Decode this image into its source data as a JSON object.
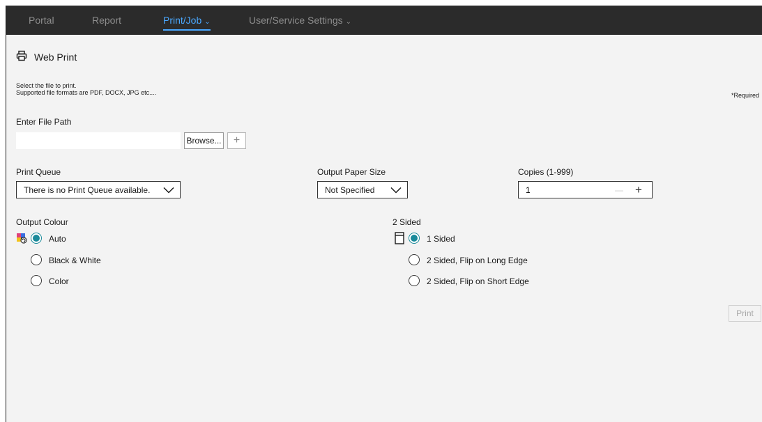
{
  "nav": {
    "items": [
      {
        "label": "Portal"
      },
      {
        "label": "Report"
      },
      {
        "label": "Print/Job"
      },
      {
        "label": "User/Service Settings"
      }
    ],
    "dropdown_marker": "⌄",
    "active_color": "#4aa8ff"
  },
  "page": {
    "title": "Web Print",
    "title_icon": "printer-icon",
    "instruction_line1": "Select the file to print.",
    "instruction_line2": "Supported file formats are PDF, DOCX, JPG etc....",
    "required_note": "*Required"
  },
  "file": {
    "label": "Enter File Path",
    "value": "",
    "browse_label": "Browse...",
    "add_label": "+"
  },
  "print_queue": {
    "label": "Print Queue",
    "selected": "There is no Print Queue available."
  },
  "paper_size": {
    "label": "Output Paper Size",
    "selected": "Not Specified"
  },
  "copies": {
    "label": "Copies (1-999)",
    "value": "1",
    "minus_label": "—",
    "plus_label": "+"
  },
  "output_colour": {
    "label": "Output Colour",
    "icon": "colour-mode-icon",
    "options": [
      {
        "label": "Auto",
        "checked": true
      },
      {
        "label": "Black & White",
        "checked": false
      },
      {
        "label": "Color",
        "checked": false
      }
    ]
  },
  "two_sided": {
    "label": "2 Sided",
    "icon": "page-icon",
    "options": [
      {
        "label": "1 Sided",
        "checked": true
      },
      {
        "label": "2 Sided, Flip on Long Edge",
        "checked": false
      },
      {
        "label": "2 Sided, Flip on Short Edge",
        "checked": false
      }
    ]
  },
  "print_button": {
    "label": "Print",
    "enabled": false
  },
  "colors": {
    "accent_radio": "#1a8a9a",
    "nav_bg": "#2b2b2b",
    "page_bg": "#f3f3f3"
  }
}
